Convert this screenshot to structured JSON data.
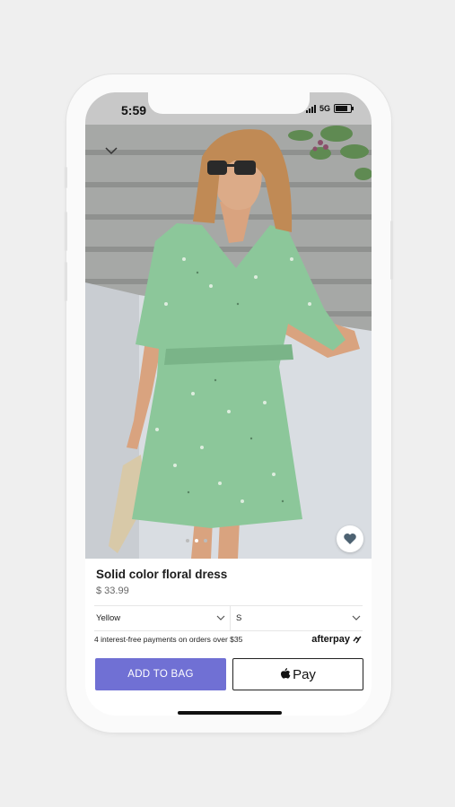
{
  "status_bar": {
    "time": "5:59",
    "network": "5G"
  },
  "product": {
    "title": "Solid color floral dress",
    "price": "$ 33.99",
    "image_dots": 3,
    "active_dot_index": 1
  },
  "options": {
    "color_selected": "Yellow",
    "size_selected": "S"
  },
  "payment": {
    "afterpay_text": "4 interest-free payments on orders over $35",
    "afterpay_logo": "afterpay",
    "add_to_bag_label": "ADD TO BAG",
    "pay_label": "Pay"
  },
  "icons": {
    "back": "chevron-down-icon",
    "favorite": "heart-icon",
    "dropdown": "chevron-down-icon",
    "apple": "apple-icon",
    "afterpay": "afterpay-loop-icon"
  },
  "colors": {
    "background": "#efefef",
    "accent_button": "#7070d4",
    "dress_green": "#8cc79a"
  }
}
